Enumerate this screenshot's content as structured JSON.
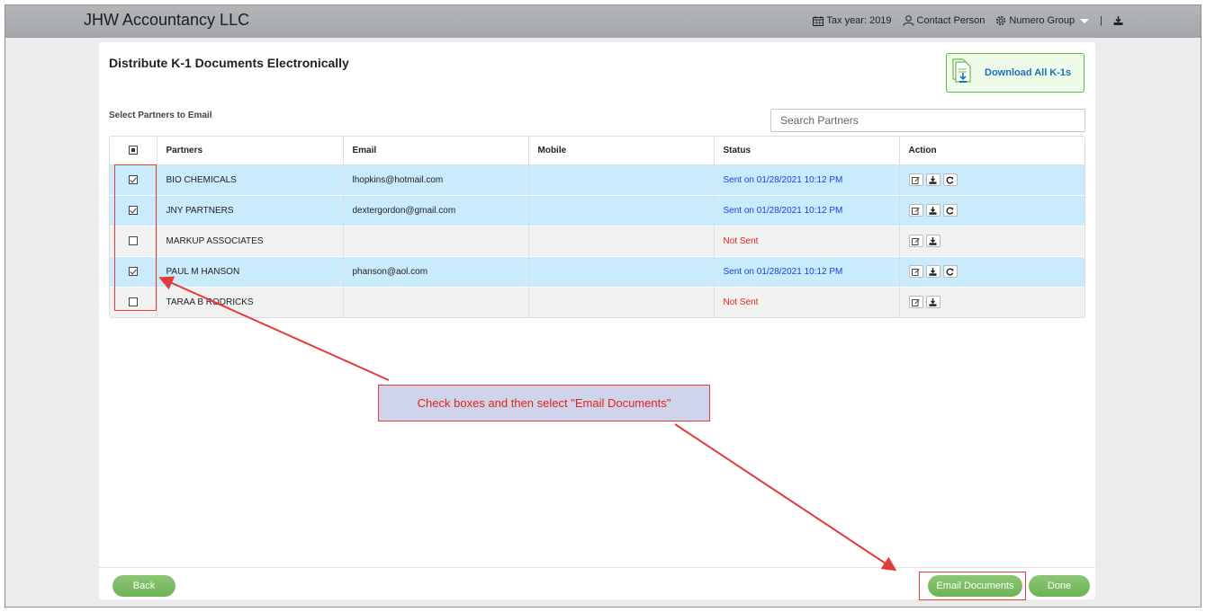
{
  "app": {
    "title": "JHW Accountancy LLC",
    "tax_year": "Tax year: 2019",
    "contact_person": "Contact Person",
    "group": "Numero Group",
    "separator": "|"
  },
  "page": {
    "title": "Distribute K-1 Documents Electronically",
    "download_all_label": "Download All K-1s",
    "section_label": "Select Partners to Email",
    "search_placeholder": "Search Partners"
  },
  "table": {
    "columns": [
      "Partners",
      "Email",
      "Mobile",
      "Status",
      "Action"
    ],
    "rows": [
      {
        "checked": true,
        "partner": "BIO CHEMICALS",
        "email": "lhopkins@hotmail.com",
        "mobile": "",
        "status": "Sent on 01/28/2021 10:12 PM",
        "status_type": "sent"
      },
      {
        "checked": true,
        "partner": "JNY PARTNERS",
        "email": "dextergordon@gmail.com",
        "mobile": "",
        "status": "Sent on 01/28/2021 10:12 PM",
        "status_type": "sent"
      },
      {
        "checked": false,
        "partner": "MARKUP ASSOCIATES",
        "email": "",
        "mobile": "",
        "status": "Not Sent",
        "status_type": "not_sent"
      },
      {
        "checked": true,
        "partner": "PAUL M HANSON",
        "email": "phanson@aol.com",
        "mobile": "",
        "status": "Sent on 01/28/2021 10:12 PM",
        "status_type": "sent"
      },
      {
        "checked": false,
        "partner": "TARAA B RODRICKS",
        "email": "",
        "mobile": "",
        "status": "Not Sent",
        "status_type": "not_sent"
      }
    ]
  },
  "annotation": {
    "text": "Check boxes and then select \"Email Documents\""
  },
  "footer": {
    "back_label": "Back",
    "email_documents_label": "Email Documents",
    "done_label": "Done"
  },
  "colors": {
    "selected_row": "#c9ebfb",
    "unselected_row": "#f1f1f1",
    "status_sent": "#1b3ee8",
    "status_not_sent": "#e0231a",
    "button_green": "#7bbd64",
    "annotation_red": "#e33b3b"
  },
  "icons": {
    "tax_year": "calendar-icon",
    "contact": "user-icon",
    "group": "gear-icon",
    "download_top": "download-icon",
    "download_all": "document-download-icon",
    "row_edit": "edit-icon",
    "row_download": "download-icon",
    "row_resend": "refresh-icon"
  }
}
